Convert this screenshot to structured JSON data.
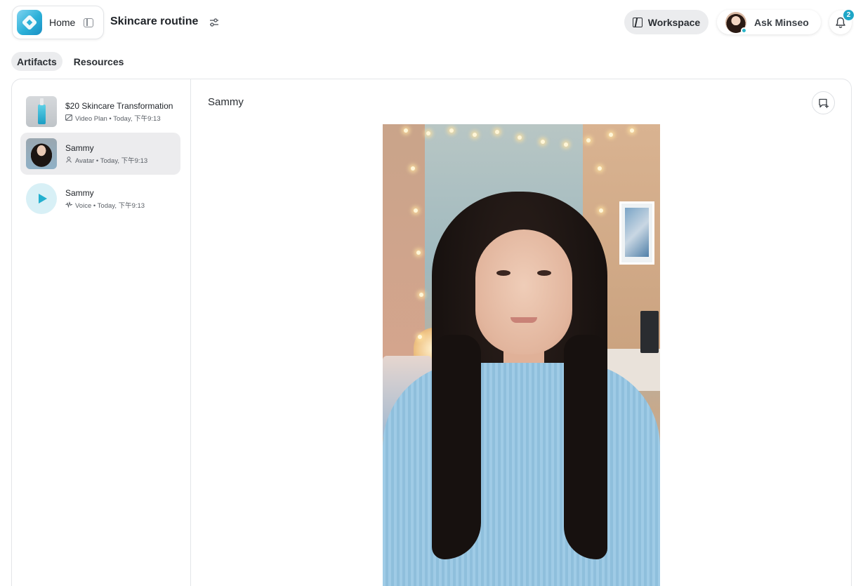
{
  "header": {
    "home_label": "Home",
    "project_title": "Skincare routine",
    "workspace_label": "Workspace",
    "ask_label": "Ask Minseo",
    "notification_count": "2"
  },
  "tabs": [
    {
      "label": "Artifacts",
      "active": true
    },
    {
      "label": "Resources",
      "active": false
    }
  ],
  "artifacts": [
    {
      "title": "$20 Skincare Transformation",
      "meta": "Video Plan • Today, 下午9:13",
      "icon": "video-plan-icon",
      "selected": false
    },
    {
      "title": "Sammy",
      "meta": "Avatar • Today, 下午9:13",
      "icon": "person-icon",
      "selected": true
    },
    {
      "title": "Sammy",
      "meta": "Voice • Today, 下午9:13",
      "icon": "voice-wave-icon",
      "selected": false
    }
  ],
  "detail": {
    "title": "Sammy"
  },
  "colors": {
    "accent": "#1fa6c7",
    "selected_bg": "#ececee",
    "border": "#e3e5e8"
  }
}
